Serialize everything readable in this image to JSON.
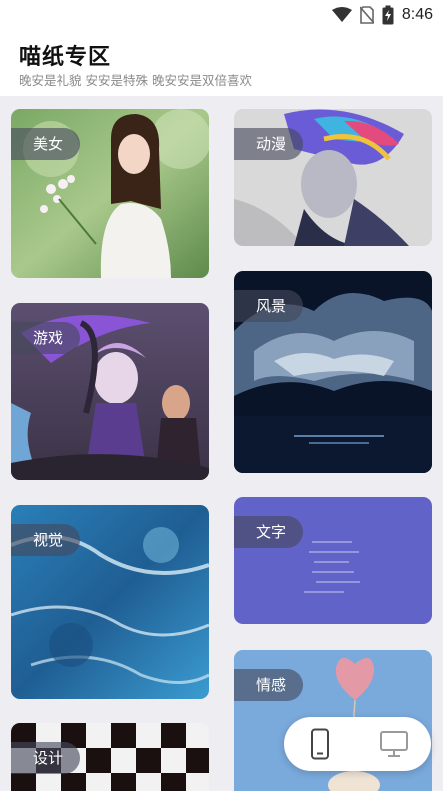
{
  "status_bar": {
    "time": "8:46"
  },
  "header": {
    "title": "喵纸专区",
    "subtitle": "晚安是礼貌 安安是特殊 晚安安是双倍喜欢"
  },
  "categories": [
    {
      "label": "美女"
    },
    {
      "label": "动漫"
    },
    {
      "label": "游戏"
    },
    {
      "label": "风景"
    },
    {
      "label": "视觉"
    },
    {
      "label": "文字"
    },
    {
      "label": "设计"
    },
    {
      "label": "情感"
    }
  ],
  "colors": {
    "accent_text_card": "#6263c8",
    "background": "#eeeef2"
  },
  "device_toggle": {
    "phone_icon": "phone-icon",
    "desktop_icon": "monitor-icon"
  }
}
